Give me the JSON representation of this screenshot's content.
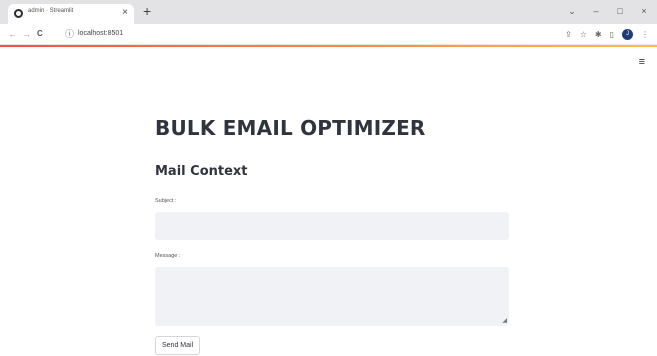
{
  "browser": {
    "tab": {
      "title": "admin · Streamlit",
      "close_glyph": "×"
    },
    "new_tab_glyph": "+",
    "window_controls": {
      "dropdown_glyph": "⌄",
      "minimize_glyph": "–",
      "maximize_glyph": "□",
      "close_glyph": "×"
    },
    "nav": {
      "back_glyph": "←",
      "forward_glyph": "→",
      "reload_glyph": "C"
    },
    "address": {
      "info_glyph": "ⓘ",
      "url": "localhost:8501"
    },
    "toolbar_icons": {
      "share_glyph": "⇪",
      "star_glyph": "☆",
      "extensions_glyph": "✱",
      "sidepanel_glyph": "▯",
      "avatar_letter": "J",
      "menu_glyph": "⋮"
    },
    "accent_colors": [
      "#ff4b4b",
      "#ffbd45"
    ]
  },
  "app": {
    "menu_glyph": "≡",
    "title": "BULK EMAIL OPTIMIZER",
    "section_title": "Mail Context",
    "subject": {
      "label": "Subject :",
      "value": ""
    },
    "message": {
      "label": "Message :",
      "value": "",
      "resize_glyph": "◢"
    },
    "send_button_label": "Send Mail",
    "input_background": "#f0f2f6",
    "text_color": "#31333f"
  }
}
